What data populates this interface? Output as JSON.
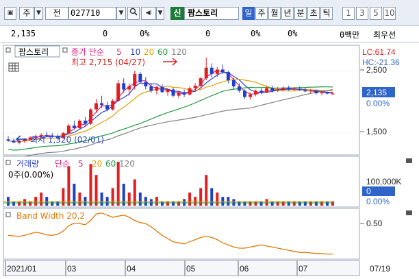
{
  "toolbar": {
    "window_icon": "window-icon",
    "period_type": "주",
    "code_label": "전",
    "stock_code": "027710",
    "search_icon": "search-icon",
    "sound_icon": "speaker-icon",
    "new_badge": "신",
    "stock_name": "팜스토리",
    "periods": [
      {
        "label": "일",
        "active": true
      },
      {
        "label": "주",
        "active": false
      },
      {
        "label": "월",
        "active": false
      },
      {
        "label": "년",
        "active": false
      },
      {
        "label": "분",
        "active": false
      },
      {
        "label": "초",
        "active": false
      },
      {
        "label": "틱",
        "active": false
      }
    ],
    "intervals": [
      "1",
      "3",
      "5",
      "10"
    ]
  },
  "infobar": {
    "price": "2,135",
    "change": "0",
    "change_pct": "0%",
    "volume": "0",
    "vol_pct1": "0%",
    "vol_pct2": "0%",
    "amount": "0백만",
    "broker": "최우선"
  },
  "price_panel": {
    "name_tag": "팜스토리",
    "ma_title": "종가 단순",
    "ma_periods": [
      "5",
      "10",
      "20",
      "60",
      "120"
    ],
    "ma_colors": [
      "#e0247a",
      "#2a3fd0",
      "#e0a000",
      "#1e9a3a",
      "#808080"
    ],
    "high_label": "최고 2,715 (04/27)",
    "low_label": "최저 1,320 (02/01)",
    "lc_label": "LC:61.74",
    "hc_label": "HC:-21.36",
    "current_price": "2,135",
    "current_pct": "0.00%",
    "y_labels": [
      "2,500",
      "1,500"
    ],
    "table_icon": "table-icon"
  },
  "volume_panel": {
    "title": "거래량",
    "ma_title": "단순",
    "ma_periods": [
      "5",
      "20",
      "60",
      "120"
    ],
    "ma_colors": [
      "#e0247a",
      "#e0a000",
      "#1e9a3a",
      "#808080"
    ],
    "current_text": "0주(0.00%)",
    "axis_label": "100,000K",
    "current_value": "0",
    "current_pct": "0.00%"
  },
  "band_panel": {
    "title": "Band Width 20,2",
    "axis_label": "0.50"
  },
  "x_axis": {
    "labels": [
      "2021/01",
      "03",
      "04",
      "05",
      "06",
      "07"
    ],
    "end_date": "07/19"
  },
  "colors": {
    "up": "#e02020",
    "down": "#1f40c8",
    "band": "#e07800",
    "price_tag": "#2f64c8"
  },
  "chart_data": {
    "type": "candlestick",
    "x_range": [
      "2021/01",
      "2021/07/19"
    ],
    "price_range": [
      1150,
      2800
    ],
    "high": {
      "value": 2715,
      "date": "04/27"
    },
    "low": {
      "value": 1320,
      "date": "02/01"
    },
    "last_close": 2135,
    "candles": [
      [
        1400,
        1450,
        1360,
        1380
      ],
      [
        1380,
        1420,
        1340,
        1350
      ],
      [
        1350,
        1400,
        1320,
        1370
      ],
      [
        1370,
        1420,
        1340,
        1400
      ],
      [
        1400,
        1450,
        1380,
        1430
      ],
      [
        1430,
        1480,
        1400,
        1450
      ],
      [
        1450,
        1500,
        1420,
        1470
      ],
      [
        1470,
        1520,
        1440,
        1460
      ],
      [
        1460,
        1500,
        1420,
        1440
      ],
      [
        1440,
        1480,
        1400,
        1420
      ],
      [
        1420,
        1520,
        1410,
        1500
      ],
      [
        1500,
        1650,
        1480,
        1620
      ],
      [
        1620,
        1700,
        1560,
        1580
      ],
      [
        1580,
        1720,
        1560,
        1700
      ],
      [
        1700,
        1760,
        1620,
        1650
      ],
      [
        1650,
        1900,
        1630,
        1880
      ],
      [
        1880,
        2050,
        1820,
        1980
      ],
      [
        1980,
        2100,
        1900,
        1950
      ],
      [
        1950,
        2000,
        1850,
        1880
      ],
      [
        1880,
        2050,
        1860,
        2020
      ],
      [
        2020,
        2350,
        2000,
        2300
      ],
      [
        2300,
        2380,
        2150,
        2200
      ],
      [
        2200,
        2300,
        2100,
        2250
      ],
      [
        2250,
        2500,
        2200,
        2450
      ],
      [
        2450,
        2480,
        2300,
        2320
      ],
      [
        2320,
        2400,
        2200,
        2250
      ],
      [
        2250,
        2300,
        2150,
        2180
      ],
      [
        2180,
        2260,
        2120,
        2240
      ],
      [
        2240,
        2280,
        2140,
        2160
      ],
      [
        2160,
        2220,
        2100,
        2200
      ],
      [
        2200,
        2230,
        2080,
        2100
      ],
      [
        2100,
        2180,
        2060,
        2150
      ],
      [
        2150,
        2200,
        2080,
        2120
      ],
      [
        2120,
        2250,
        2100,
        2220
      ],
      [
        2220,
        2300,
        2180,
        2260
      ],
      [
        2260,
        2400,
        2220,
        2380
      ],
      [
        2380,
        2715,
        2350,
        2550
      ],
      [
        2550,
        2620,
        2400,
        2450
      ],
      [
        2450,
        2560,
        2400,
        2520
      ],
      [
        2520,
        2600,
        2450,
        2480
      ],
      [
        2480,
        2500,
        2300,
        2350
      ],
      [
        2350,
        2380,
        2200,
        2250
      ],
      [
        2250,
        2300,
        2150,
        2180
      ],
      [
        2180,
        2200,
        2050,
        2080
      ],
      [
        2080,
        2150,
        2040,
        2120
      ],
      [
        2120,
        2200,
        2090,
        2180
      ],
      [
        2180,
        2220,
        2120,
        2160
      ],
      [
        2160,
        2250,
        2140,
        2220
      ],
      [
        2220,
        2260,
        2150,
        2180
      ],
      [
        2180,
        2240,
        2160,
        2200
      ],
      [
        2200,
        2250,
        2170,
        2230
      ],
      [
        2230,
        2260,
        2180,
        2200
      ],
      [
        2200,
        2240,
        2170,
        2210
      ],
      [
        2210,
        2250,
        2180,
        2190
      ],
      [
        2190,
        2230,
        2160,
        2170
      ],
      [
        2170,
        2210,
        2140,
        2180
      ],
      [
        2180,
        2200,
        2120,
        2140
      ],
      [
        2140,
        2180,
        2110,
        2160
      ],
      [
        2160,
        2170,
        2120,
        2135
      ],
      [
        2135,
        2160,
        2110,
        2135
      ]
    ],
    "volume_spikes": [
      0.2,
      0.1,
      0.1,
      0.15,
      0.1,
      0.2,
      0.3,
      0.2,
      0.1,
      0.1,
      0.4,
      0.9,
      0.5,
      0.3,
      0.2,
      0.95,
      0.7,
      0.3,
      0.2,
      0.4,
      1.0,
      0.5,
      0.3,
      0.6,
      0.3,
      0.2,
      0.15,
      0.2,
      0.1,
      0.1,
      0.1,
      0.1,
      0.15,
      0.3,
      0.2,
      0.4,
      0.7,
      0.4,
      0.3,
      0.2,
      0.2,
      0.15,
      0.1,
      0.1,
      0.1,
      0.1,
      0.1,
      0.15,
      0.1,
      0.1,
      0.1,
      0.1,
      0.1,
      0.1,
      0.1,
      0.1,
      0.1,
      0.1,
      0.1,
      0.1
    ],
    "band_width": [
      0.42,
      0.41,
      0.4,
      0.42,
      0.45,
      0.48,
      0.46,
      0.43,
      0.42,
      0.44,
      0.5,
      0.6,
      0.65,
      0.64,
      0.62,
      0.7,
      0.82,
      0.84,
      0.8,
      0.76,
      0.78,
      0.8,
      0.76,
      0.7,
      0.66,
      0.64,
      0.58,
      0.5,
      0.42,
      0.36,
      0.3,
      0.28,
      0.26,
      0.3,
      0.34,
      0.38,
      0.4,
      0.38,
      0.34,
      0.28,
      0.24,
      0.2,
      0.18,
      0.18,
      0.2,
      0.22,
      0.24,
      0.22,
      0.2,
      0.18,
      0.16,
      0.14,
      0.12,
      0.1,
      0.1,
      0.09,
      0.08,
      0.08,
      0.07,
      0.07
    ],
    "band_range": [
      0.0,
      0.9
    ]
  }
}
